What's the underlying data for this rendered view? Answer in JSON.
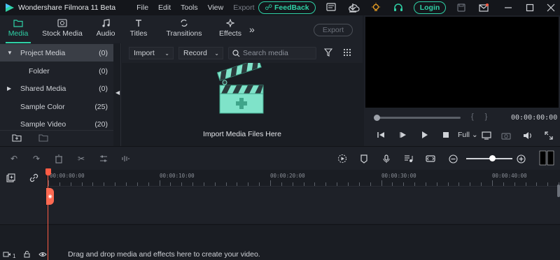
{
  "titlebar": {
    "app_title": "Wondershare Filmora 11 Beta",
    "menu": [
      "File",
      "Edit",
      "Tools",
      "View",
      "Export"
    ],
    "feedback_label": "FeedBack",
    "login_label": "Login"
  },
  "media_tabs": [
    {
      "label": "Media",
      "icon": "folder-icon"
    },
    {
      "label": "Stock Media",
      "icon": "cloud-icon"
    },
    {
      "label": "Audio",
      "icon": "music-note-icon"
    },
    {
      "label": "Titles",
      "icon": "text-icon"
    },
    {
      "label": "Transitions",
      "icon": "transition-icon"
    },
    {
      "label": "Effects",
      "icon": "sparkle-icon"
    }
  ],
  "export_label": "Export",
  "left_panel": {
    "items": [
      {
        "label": "Project Media",
        "count": "(0)"
      },
      {
        "label": "Folder",
        "count": "(0)"
      },
      {
        "label": "Shared Media",
        "count": "(0)"
      },
      {
        "label": "Sample Color",
        "count": "(25)"
      },
      {
        "label": "Sample Video",
        "count": "(20)"
      }
    ]
  },
  "media_area": {
    "import_label": "Import",
    "record_label": "Record",
    "search_placeholder": "Search media",
    "import_hint": "Import Media Files Here"
  },
  "preview": {
    "timecode": "00:00:00:00",
    "quality": "Full"
  },
  "timeline": {
    "ruler_labels": [
      "00:00:00:00",
      "00:00:10:00",
      "00:00:20:00",
      "00:00:30:00",
      "00:00:40:00"
    ],
    "drop_hint": "Drag and drop media and effects here to create your video.",
    "track_number": "1"
  },
  "colors": {
    "accent": "#2fd1a6",
    "playhead": "#ff5c45"
  }
}
